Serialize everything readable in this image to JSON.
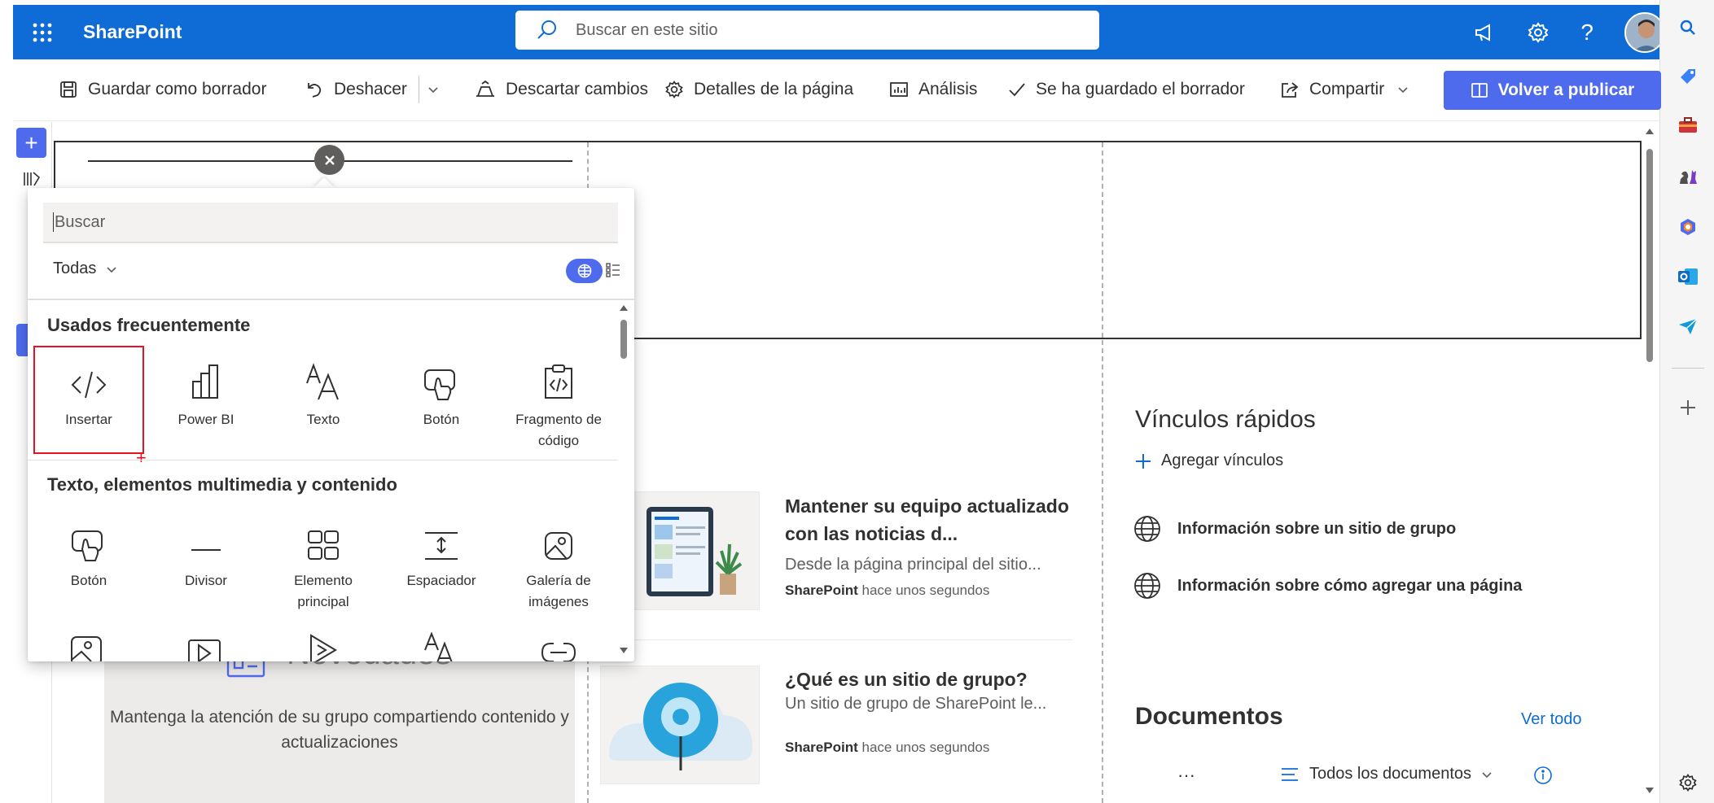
{
  "suitebar": {
    "brand": "SharePoint",
    "search_placeholder": "Buscar en este sitio",
    "help": "?"
  },
  "commandbar": {
    "save_draft": "Guardar como borrador",
    "undo": "Deshacer",
    "discard": "Descartar cambios",
    "page_details": "Detalles de la página",
    "analytics": "Análisis",
    "saved_status": "Se ha guardado el borrador",
    "share": "Compartir",
    "republish": "Volver a publicar"
  },
  "picker": {
    "search_placeholder": "Buscar",
    "filter": "Todas",
    "frequent_title": "Usados frecuentemente",
    "frequent": [
      {
        "label": "Insertar",
        "icon": "embed-icon"
      },
      {
        "label": "Power BI",
        "icon": "power-bi-icon"
      },
      {
        "label": "Texto",
        "icon": "text-icon"
      },
      {
        "label": "Botón",
        "icon": "button-icon"
      },
      {
        "label": "Fragmento de código",
        "icon": "code-snippet-icon"
      }
    ],
    "media_title": "Texto, elementos multimedia y contenido",
    "media": [
      {
        "label": "Botón",
        "icon": "button-icon"
      },
      {
        "label": "Divisor",
        "icon": "divider-icon"
      },
      {
        "label": "Elemento principal",
        "icon": "hero-icon"
      },
      {
        "label": "Espaciador",
        "icon": "spacer-icon"
      },
      {
        "label": "Galería de imágenes",
        "icon": "image-gallery-icon"
      }
    ]
  },
  "page": {
    "news_title": "Novedades",
    "news_text": "Mantenga la atención de su grupo compartiendo contenido y actualizaciones",
    "news_items": [
      {
        "title": "Mantener su equipo actualizado con las noticias d...",
        "desc": "Desde la página principal del sitio...",
        "author": "SharePoint",
        "time": "hace unos segundos"
      },
      {
        "title": "¿Qué es un sitio de grupo?",
        "desc": "Un sitio de grupo de SharePoint le...",
        "author": "SharePoint",
        "time": "hace unos segundos"
      }
    ],
    "quick_links_title": "Vínculos rápidos",
    "add_links": "Agregar vínculos",
    "links": [
      "Información sobre un sitio de grupo",
      "Información sobre cómo agregar una página"
    ],
    "docs_title": "Documentos",
    "see_all": "Ver todo",
    "docs_view": "Todos los documentos",
    "more": "···"
  },
  "colors": {
    "suitebar": "#0f6cd7",
    "accent": "#4f6bed",
    "selection": "#e81123"
  }
}
